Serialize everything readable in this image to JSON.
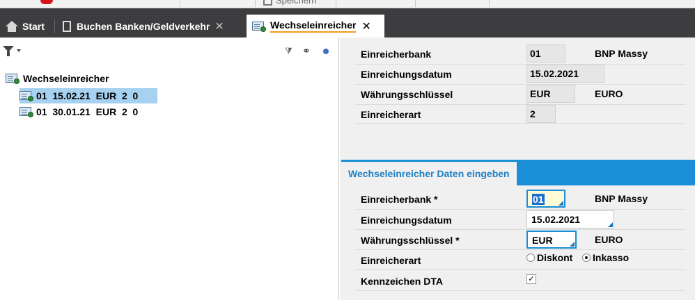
{
  "toolbar": {
    "save_label": "Speichern"
  },
  "tabs": {
    "start": {
      "label": "Start"
    },
    "buchen": {
      "label": "Buchen Banken/Geldverkehr",
      "close": "✕"
    },
    "active": {
      "label": "Wechseleinreicher",
      "close": "✕"
    }
  },
  "tree": {
    "root_label": "Wechseleinreicher",
    "items": [
      {
        "label": "01  15.02.21  EUR  2  0",
        "selected": true
      },
      {
        "label": "01  30.01.21  EUR  2  0",
        "selected": false
      }
    ]
  },
  "details": {
    "rows": [
      {
        "label": "Einreicherbank",
        "value": "01",
        "description": "BNP Massy"
      },
      {
        "label": "Einreichungsdatum",
        "value": "15.02.2021",
        "description": ""
      },
      {
        "label": "Währungsschlüssel",
        "value": "EUR",
        "description": "EURO"
      },
      {
        "label": "Einreicherart",
        "value": "2",
        "description": ""
      }
    ]
  },
  "form": {
    "section_title": "Wechseleinreicher Daten eingeben",
    "bank_label": "Einreicherbank *",
    "bank_value": "01",
    "bank_desc": "BNP Massy",
    "date_label": "Einreichungsdatum",
    "date_value": "15.02.2021",
    "currency_label": "Währungsschlüssel *",
    "currency_value": "EUR",
    "currency_desc": "EURO",
    "type_label": "Einreicherart",
    "type_options": [
      "Diskont",
      "Inkasso"
    ],
    "type_selected": "Inkasso",
    "dta_label": "Kennzeichen DTA",
    "dta_checked": true
  },
  "colors": {
    "accent": "#1a8ed6",
    "tabbar": "#3d3d3f",
    "selection": "#a6d1f0",
    "tab_underline": "#f39a1e"
  }
}
